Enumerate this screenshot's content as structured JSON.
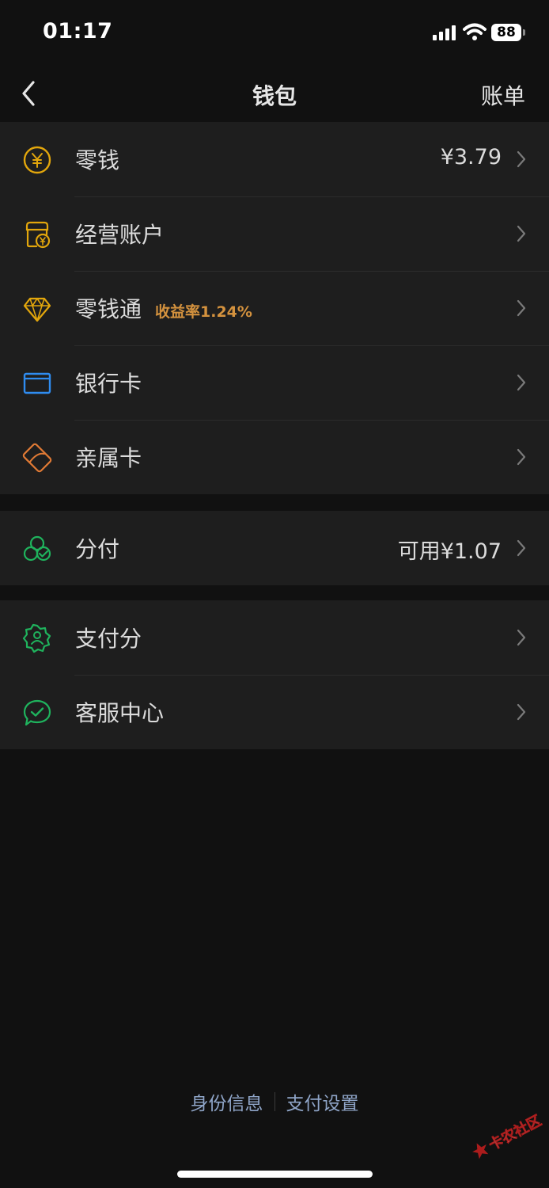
{
  "status_bar": {
    "time": "01:17",
    "battery": "88"
  },
  "nav": {
    "title": "钱包",
    "right_label": "账单"
  },
  "groups": [
    [
      {
        "label": "零钱",
        "value": "¥3.79",
        "icon": "yuan-coin-icon",
        "color": "#e2a60c"
      },
      {
        "label": "经营账户",
        "icon": "shop-account-icon",
        "color": "#e2a60c"
      },
      {
        "label": "零钱通",
        "tag": "收益率1.24%",
        "icon": "diamond-icon",
        "color": "#e2a60c"
      },
      {
        "label": "银行卡",
        "icon": "bank-card-icon",
        "color": "#2f8cf0"
      },
      {
        "label": "亲属卡",
        "icon": "family-card-icon",
        "color": "#e07a35"
      }
    ],
    [
      {
        "label": "分付",
        "value": "可用¥1.07",
        "icon": "fenfu-icon",
        "color": "#1fb35d"
      }
    ],
    [
      {
        "label": "支付分",
        "icon": "payscore-badge-icon",
        "color": "#1fb35d"
      },
      {
        "label": "客服中心",
        "icon": "service-chat-icon",
        "color": "#1fb35d"
      }
    ]
  ],
  "footer": {
    "identity_label": "身份信息",
    "settings_label": "支付设置"
  },
  "watermark": {
    "text": "卡农社区"
  }
}
